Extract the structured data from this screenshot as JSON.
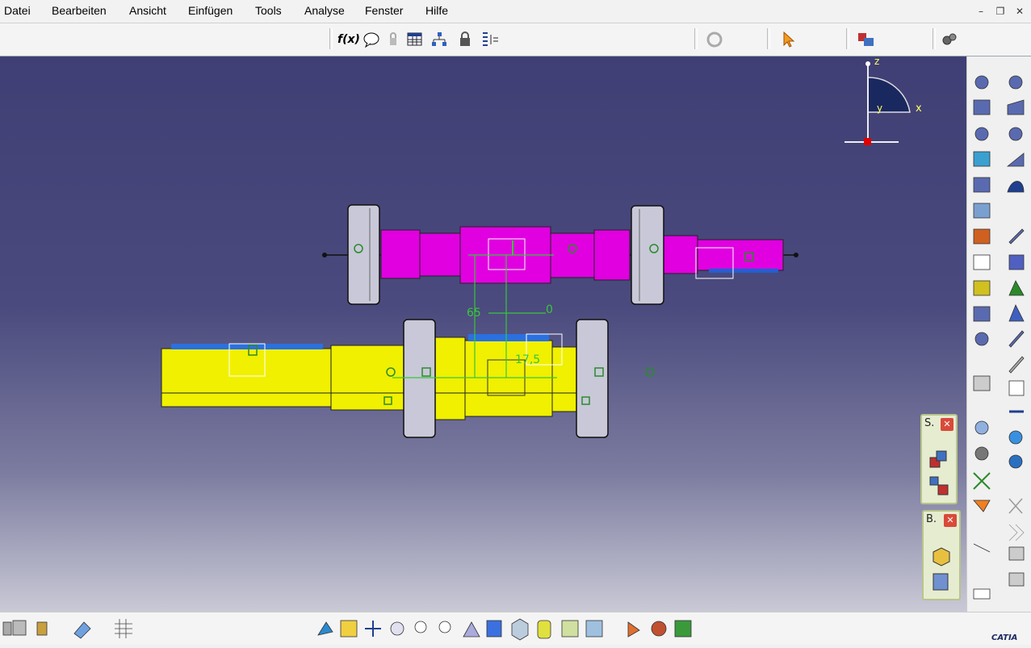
{
  "menu": {
    "items": [
      "Datei",
      "Bearbeiten",
      "Ansicht",
      "Einfügen",
      "Tools",
      "Analyse",
      "Fenster",
      "Hilfe"
    ]
  },
  "window_controls": {
    "minimize": "–",
    "restore": "❐",
    "close": "✕"
  },
  "top_toolbar": {
    "formula_label": "f(x)",
    "icons": [
      "formula-icon",
      "comment-icon",
      "lock-icon",
      "table-icon",
      "tree-icon",
      "padlock-icon",
      "list-icon",
      "refresh-icon",
      "select-arrow-icon",
      "catalog-icon",
      "gears-icon"
    ]
  },
  "compass": {
    "x_label": "x",
    "y_label": "y",
    "z_label": "z"
  },
  "model": {
    "dim_65": "65",
    "dim_0": "0",
    "dim_17_5": "17,5"
  },
  "float_panels": [
    {
      "title": "S.",
      "close": "✕"
    },
    {
      "title": "B.",
      "close": "✕"
    }
  ],
  "colors": {
    "shaft_top": "#e000e0",
    "shaft_bottom": "#f0f000",
    "wheel": "#c8c8d8",
    "dimension": "#39c639",
    "viewport_top": "#3f3f75",
    "viewport_bottom": "#c9c9d6"
  },
  "brand": {
    "logo": "CATIA"
  }
}
